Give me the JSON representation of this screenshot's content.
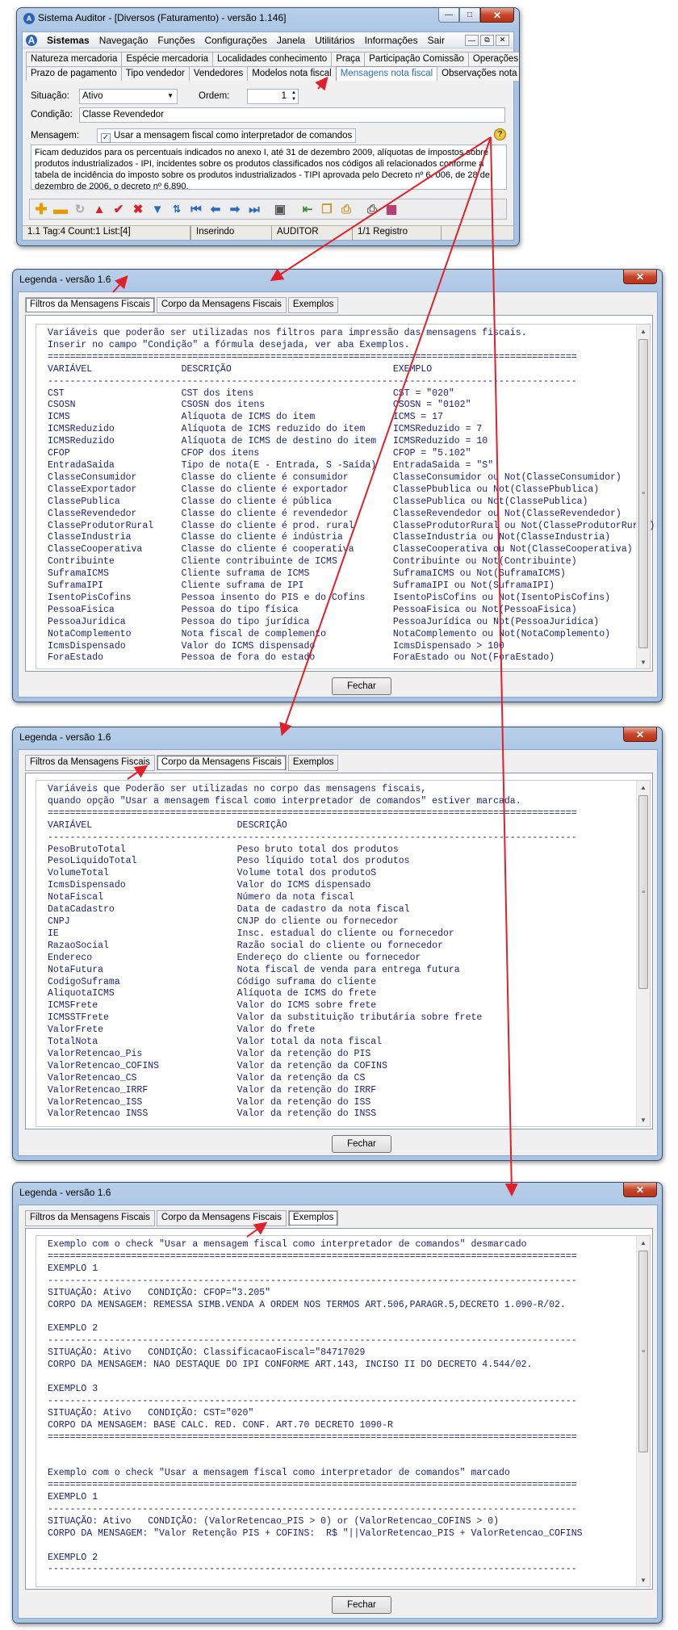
{
  "main": {
    "title": "Sistema Auditor - [Diversos (Faturamento) - versão 1.146]",
    "menu": [
      "Sistemas",
      "Navegação",
      "Funções",
      "Configurações",
      "Janela",
      "Utilitários",
      "Informações",
      "Sair"
    ],
    "tabs1": [
      "Natureza mercadoria",
      "Espécie mercadoria",
      "Localidades conhecimento",
      "Praça",
      "Participação Comissão",
      "Operações Caixa"
    ],
    "tabs2": [
      "Prazo de pagamento",
      "Tipo vendedor",
      "Vendedores",
      "Modelos nota fiscal",
      "Mensagens nota fiscal",
      "Observações nota fiscal"
    ],
    "situacao_label": "Situação:",
    "situacao_value": "Ativo",
    "ordem_label": "Ordem:",
    "ordem_value": "1",
    "condicao_label": "Condição:",
    "condicao_value": "Classe Revendedor",
    "mensagem_label": "Mensagem:",
    "checkbox_label": "Usar a mensagem fiscal como interpretador de comandos",
    "message_text": "Ficam deduzidos para os percentuais indicados no anexo I, até 31 de dezembro 2009, alíquotas de impostos sobre produtos industrializados - IPI, incidentes sobre os produtos classificados nos códigos ali relacionados conforme a tabela de incidência do imposto sobre os produtos industrializados - TIPI aprovada pelo Decreto nº 6. 006, de 28 de dezembro de 2006, o decreto nº 6.890.",
    "status": [
      "1.1 Tag:4 Count:1 List:[4]",
      "",
      "Inserindo",
      "AUDITOR",
      "1/1 Registro"
    ]
  },
  "legend_title": "Legenda - versão 1.6",
  "legend_tabs": [
    "Filtros da Mensagens Fiscais",
    "Corpo da Mensagens Fiscais",
    "Exemplos"
  ],
  "fechar": "Fechar",
  "filtros_text": "Variáveis que poderão ser utilizadas nos filtros para impressão das mensagens fiscais.\nInserir no campo \"Condição\" a fórmula desejada, ver aba Exemplos.\n===============================================================================================\nVARIÁVEL                DESCRIÇÃO                             EXEMPLO\n-----------------------------------------------------------------------------------------------\nCST                     CST dos itens                         CST = \"020\"\nCSOSN                   CSOSN dos itens                       CSOSN = \"0102\"\nICMS                    Alíquota de ICMS do item              ICMS = 17\nICMSReduzido            Alíquota de ICMS reduzido do item     ICMSReduzido = 7\nICMSReduzido            Alíquota de ICMS de destino do item   ICMSReduzido = 10\nCFOP                    CFOP dos itens                        CFOP = \"5.102\"\nEntradaSaida            Tipo de nota(E - Entrada, S -Saída)   EntradaSaida = \"S\"\nClasseConsumidor        Classe do cliente é consumidor        ClasseConsumidor ou Not(ClasseConsumidor)\nClasseExportador        Classe do cliente é exportador        ClassePbublica ou Not(ClassePbublica)\nClassePublica           Classe do cliente é pública           ClassePublica ou Not(ClassePublica)\nClasseRevendedor        Classe do cliente é revendedor        ClasseRevendedor ou Not(ClasseRevendedor)\nClasseProdutorRural     Classe do cliente é prod. rural       ClasseProdutorRural ou Not(ClasseProdutorRural)\nClasseIndustria         Classe do cliente é indústria         ClasseIndustria ou Not(ClasseIndustria)\nClasseCooperativa       Classe do cliente é cooperativa       ClasseCooperativa ou Not(ClasseCooperativa)\nContribuinte            Cliente contribuinte de ICMS          Contribuinte ou Not(Contribuinte)\nSuframaICMS             Cliente suframa de ICMS               SuframaICMS ou Not(SuframaICMS)\nSuframaIPI              Cliente suframa de IPI                SuframaIPI ou Not(SuframaIPI)\nIsentoPisCofins         Pessoa insento do PIS e do Cofins     IsentoPisCofins ou Not(IsentoPisCofins)\nPessoaFisica            Pessoa do tipo física                 PessoaFisica ou Not(PessoaFisica)\nPessoaJuridica          Pessoa do tipo jurídica               PessoaJurídica ou Not(PessoaJuridica)\nNotaComplemento         Nota fiscal de complemento            NotaComplemento ou Not(NotaComplemento)\nIcmsDispensado          Valor do ICMS dispensado              IcmsDispensado > 100\nForaEstado              Pessoa de fora do estado              ForaEstado ou Not(ForaEstado)",
  "corpo_text": "Variáveis que Poderão ser utilizadas no corpo das mensagens fiscais,\nquando opção \"Usar a mensagem fiscal como interpretador de comandos\" estiver marcada.\n===============================================================================================\nVARIÁVEL                          DESCRIÇÃO\n-----------------------------------------------------------------------------------------------\nPesoBrutoTotal                    Peso bruto total dos produtos\nPesoLiquidoTotal                  Peso líquido total dos produtos\nVolumeTotal                       Volume total dos produtoS\nIcmsDispensado                    Valor do ICMS dispensado\nNotaFiscal                        Número da nota fiscal\nDataCadastro                      Data de cadastro da nota fiscal\nCNPJ                              CNJP do cliente ou fornecedor\nIE                                Insc. estadual do cliente ou fornecedor\nRazaoSocial                       Razão social do cliente ou fornecedor\nEndereco                          Endereço do cliente ou fornecedor\nNotaFutura                        Nota fiscal de venda para entrega futura\nCodigoSuframa                     Código suframa do cliente\nAliquotaICMS                      Alíquota de ICMS do frete\nICMSFrete                         Valor do ICMS sobre frete\nICMSSTFrete                       Valor da substituição tributária sobre frete\nValorFrete                        Valor do frete\nTotalNota                         Valor total da nota fiscal\nValorRetencao_Pis                 Valor da retenção do PIS\nValorRetencao_COFINS              Valor da retenção da COFINS\nValorRetencao_CS                  Valor da retenção da CS\nValorRetencao_IRRF                Valor da retenção do IRRF\nValorRetencao_ISS                 Valor da retenção do ISS\nValorRetencao INSS                Valor da retenção do INSS",
  "exemplos_text": "Exemplo com o check \"Usar a mensagem fiscal como interpretador de comandos\" desmarcado\n===============================================================================================\nEXEMPLO 1\n-----------------------------------------------------------------------------------------------\nSITUAÇÃO: Ativo   CONDIÇÃO: CFOP=\"3.205\"\nCORPO DA MENSAGEM: REMESSA SIMB.VENDA A ORDEM NOS TERMOS ART.506,PARAGR.5,DECRETO 1.090-R/02.\n\nEXEMPLO 2\n-----------------------------------------------------------------------------------------------\nSITUAÇÃO: Ativo   CONDIÇÃO: ClassificacaoFiscal=\"84717029\nCORPO DA MENSAGEM: NAO DESTAQUE DO IPI CONFORME ART.143, INCISO II DO DECRETO 4.544/02.\n\nEXEMPLO 3\n-----------------------------------------------------------------------------------------------\nSITUAÇÃO: Ativo   CONDIÇÃO: CST=\"020\"\nCORPO DA MENSAGEM: BASE CALC. RED. CONF. ART.70 DECRETO 1090-R\n===============================================================================================\n\n\nExemplo com o check \"Usar a mensagem fiscal como interpretador de comandos\" marcado\n===============================================================================================\nEXEMPLO 1\n-----------------------------------------------------------------------------------------------\nSITUAÇÃO: Ativo   CONDIÇÃO: (ValorRetencao_PIS > 0) or (ValorRetencao_COFINS > 0)\nCORPO DA MENSAGEM: \"Valor Retenção PIS + COFINS:  R$ \"||ValorRetencao_PIS + ValorRetencao_COFINS\n\nEXEMPLO 2\n-----------------------------------------------------------------------------------------------",
  "colors": {
    "arrow": "#e0202a",
    "selected_tab": "#2d6cc7",
    "mono_text": "#1a1f6e"
  }
}
